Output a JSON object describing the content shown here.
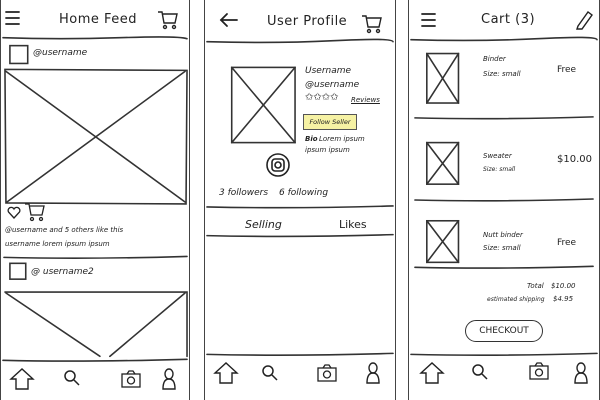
{
  "feed": {
    "title": "Home Feed",
    "post1_user": "@username",
    "post1_likes": "@username and 5 others like this",
    "post1_caption": "username lorem ipsum ipsum",
    "post2_user": "@ username2"
  },
  "profile": {
    "title": "User Profile",
    "name": "Username",
    "handle": "@username",
    "stars": "✩✩✩✩",
    "reviews_link": "Reviews",
    "follow_button": "Follow Seller",
    "bio_label": "Bio",
    "bio_line1": "Lorem ipsum",
    "bio_line2": "ipsum ipsum",
    "followers": "3 followers",
    "following": "6 following",
    "tab_selling": "Selling",
    "tab_likes": "Likes"
  },
  "cart": {
    "title": "Cart (3)",
    "items": [
      {
        "name": "Binder",
        "size": "Size: small",
        "price": "Free"
      },
      {
        "name": "Sweater",
        "size": "Size: small",
        "price": "$10.00"
      },
      {
        "name": "Nutt binder",
        "size": "Size: small",
        "price": "Free"
      }
    ],
    "total_label": "Total",
    "total_value": "$10.00",
    "shipping_label": "estimated shipping",
    "shipping_value": "$4.95",
    "checkout_button": "CHECKOUT"
  },
  "nav_icons": [
    "home-icon",
    "search-icon",
    "camera-icon",
    "profile-icon"
  ]
}
